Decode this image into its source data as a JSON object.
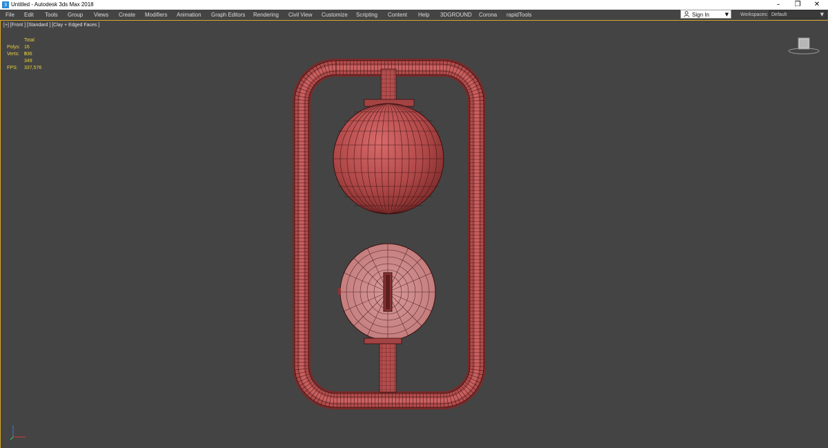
{
  "window": {
    "title": "Untitled - Autodesk 3ds Max 2018",
    "controls": {
      "minimize": "–",
      "restore": "❐",
      "close": "✕"
    }
  },
  "menu": {
    "items": [
      "File",
      "Edit",
      "Tools",
      "Group",
      "Views",
      "Create",
      "Modifiers",
      "Animation",
      "Graph Editors",
      "Rendering",
      "Civil View",
      "Customize",
      "Scripting",
      "Content",
      "Help",
      "3DGROUND",
      "Corona",
      "rapidTools"
    ]
  },
  "signin": {
    "label": "Sign In"
  },
  "workspaces": {
    "label": "Workspaces:",
    "value": "Default"
  },
  "viewport": {
    "label": "[+] [Front ] [Standard ] [Clay + Edged Faces ]",
    "stats": {
      "header": "Total",
      "polys_label": "Polys:",
      "polys_value": "16 536",
      "verts_label": "Verts:",
      "verts_value": "8 349",
      "fps_label": "FPS:",
      "fps_value": "337,576"
    }
  },
  "colors": {
    "viewport_bg": "#444444",
    "accent": "#d7a82b",
    "stats_text": "#e8d23a",
    "model_red": "#b34d4d",
    "wire": "#3a1010"
  },
  "icons": [
    "app-icon",
    "user-icon",
    "chevron-down-icon",
    "viewcube-icon",
    "axis-gizmo-icon"
  ]
}
